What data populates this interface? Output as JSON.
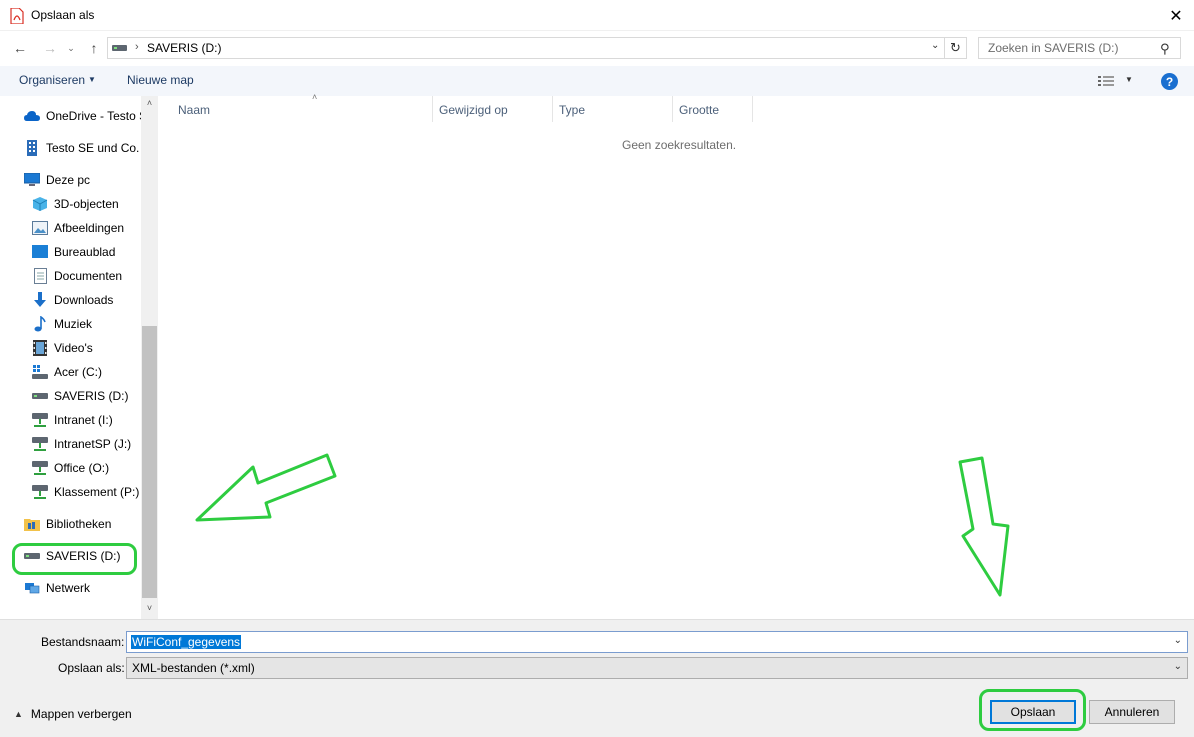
{
  "window": {
    "title": "Opslaan als",
    "close_glyph": "✕"
  },
  "nav": {
    "back_glyph": "←",
    "forward_glyph": "→",
    "recent_glyph": "⌄",
    "up_glyph": "↑"
  },
  "address": {
    "separator": "›",
    "path": "SAVERIS (D:)",
    "chevron": "⌄",
    "refresh_glyph": "↻"
  },
  "search": {
    "placeholder": "Zoeken in SAVERIS (D:)",
    "icon_glyph": "⚲"
  },
  "toolbar": {
    "organize_label": "Organiseren",
    "organize_arrow": "▼",
    "new_folder_label": "Nieuwe map",
    "view_arrow": "▼",
    "help_glyph": "?"
  },
  "sidebar": {
    "items": [
      {
        "label": "OneDrive - Testo S",
        "icon": "onedrive-icon"
      },
      {
        "label": "Testo SE und Co. K",
        "icon": "building-icon"
      },
      {
        "label": "Deze pc",
        "icon": "computer-icon"
      },
      {
        "label": "3D-objecten",
        "icon": "3d-objects-icon"
      },
      {
        "label": "Afbeeldingen",
        "icon": "pictures-icon"
      },
      {
        "label": "Bureaublad",
        "icon": "desktop-icon"
      },
      {
        "label": "Documenten",
        "icon": "documents-icon"
      },
      {
        "label": "Downloads",
        "icon": "download-icon"
      },
      {
        "label": "Muziek",
        "icon": "music-icon"
      },
      {
        "label": "Video's",
        "icon": "video-icon"
      },
      {
        "label": "Acer (C:)",
        "icon": "windows-drive-icon"
      },
      {
        "label": "SAVERIS (D:)",
        "icon": "drive-icon"
      },
      {
        "label": "Intranet (I:)",
        "icon": "network-drive-icon"
      },
      {
        "label": "IntranetSP (J:)",
        "icon": "network-drive-icon"
      },
      {
        "label": "Office (O:)",
        "icon": "network-drive-icon"
      },
      {
        "label": "Klassement (P:)",
        "icon": "network-drive-icon"
      },
      {
        "label": "Bibliotheken",
        "icon": "libraries-icon"
      },
      {
        "label": "SAVERIS (D:)",
        "icon": "drive-icon"
      },
      {
        "label": "Netwerk",
        "icon": "network-icon"
      }
    ],
    "scroll_up": "˄",
    "scroll_down": "˅"
  },
  "filelist": {
    "columns": [
      "Naam",
      "Gewijzigd op",
      "Type",
      "Grootte"
    ],
    "sort_glyph": "˄",
    "empty_text": "Geen zoekresultaten."
  },
  "form": {
    "filename_label": "Bestandsnaam:",
    "filename_value": "WiFiConf_gegevens",
    "filetype_label": "Opslaan als:",
    "filetype_value": "XML-bestanden (*.xml)",
    "chevron": "⌄"
  },
  "footer": {
    "hide_folders_label": "Mappen verbergen",
    "hide_folders_glyph": "▲",
    "save_label": "Opslaan",
    "cancel_label": "Annuleren"
  },
  "colors": {
    "accent": "#0078d7",
    "annotation_green": "#2ecc40",
    "command_bar": "#f3f6fb"
  }
}
